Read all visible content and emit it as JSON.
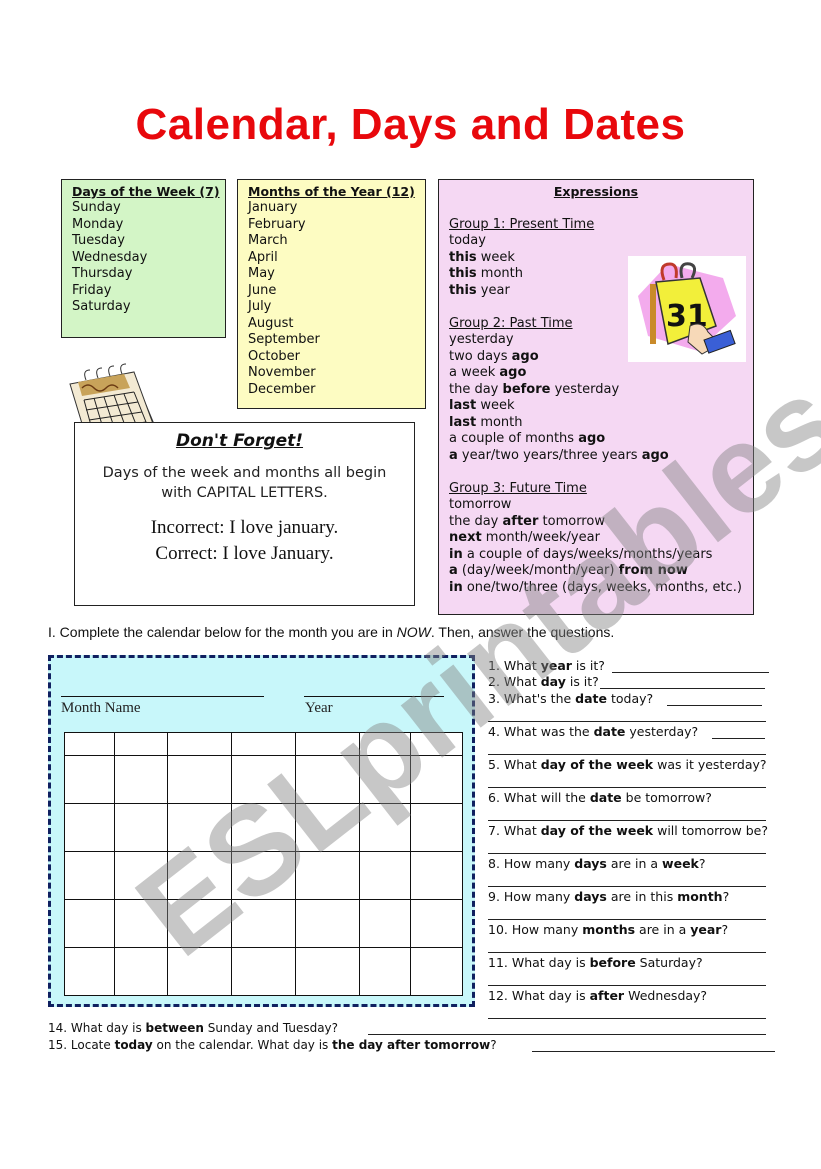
{
  "title": "Calendar, Days and Dates",
  "days_box": {
    "heading": "Days of the Week (7)",
    "items": [
      "Sunday",
      "Monday",
      "Tuesday",
      "Wednesday",
      "Thursday",
      "Friday",
      "Saturday"
    ]
  },
  "months_box": {
    "heading": "Months of the Year (12)",
    "items": [
      "January",
      "February",
      "March",
      "April",
      "May",
      "June",
      "July",
      "August",
      "September",
      "October",
      "November",
      "December"
    ]
  },
  "expressions": {
    "heading": "Expressions",
    "groups": [
      {
        "title": "Group 1:  Present Time",
        "items": [
          {
            "bold": "",
            "rest": "today"
          },
          {
            "bold": "this",
            "rest": " week"
          },
          {
            "bold": "this",
            "rest": " month"
          },
          {
            "bold": "this",
            "rest": " year"
          }
        ]
      },
      {
        "title": "Group 2:  Past Time",
        "items": [
          {
            "pre": "yesterday"
          },
          {
            "pre": "two days ",
            "bold": "ago"
          },
          {
            "pre": "a week ",
            "bold": "ago"
          },
          {
            "pre": "the day ",
            "bold": "before",
            "post": " yesterday"
          },
          {
            "bold": "last",
            "post": " week"
          },
          {
            "bold": "last",
            "post": " month"
          },
          {
            "pre": "a couple of months ",
            "bold": "ago"
          },
          {
            "bold": "a",
            "post": " year/two years/three years ",
            "bold2": "ago"
          }
        ]
      },
      {
        "title": "Group 3:  Future Time",
        "items": [
          {
            "pre": "tomorrow"
          },
          {
            "pre": "the day ",
            "bold": "after",
            "post": " tomorrow"
          },
          {
            "bold": "next",
            "post": " month/week/year"
          },
          {
            "bold": "in",
            "post": " a couple of days/weeks/months/years"
          },
          {
            "bold": "a",
            "post": " (day/week/month/year)  ",
            "bold2": "from now"
          },
          {
            "bold": "in",
            "post": " one/two/three (days, weeks, months, etc.)"
          }
        ]
      }
    ]
  },
  "images": {
    "calendar_clipart": "calendar-clipart",
    "day31_clipart": "31"
  },
  "note": {
    "title": "Don't Forget!",
    "body_line1": "Days of the week and months all begin",
    "body_line2": "with CAPITAL LETTERS.",
    "incorrect": "Incorrect: I love january.",
    "correct": "Correct:  I love January."
  },
  "instruction": {
    "prefix": "I.  Complete the calendar below for the month you are in ",
    "emph": "NOW",
    "suffix": ".  Then, answer the questions."
  },
  "calendar": {
    "month_label": "Month Name",
    "year_label": "Year",
    "rows": 6,
    "cols": 7
  },
  "questions": [
    {
      "n": "1.",
      "pre": " What ",
      "bold": "year",
      "post": " is it?"
    },
    {
      "n": "2.",
      "pre": " What ",
      "bold": "day",
      "post": " is it?"
    },
    {
      "n": "3.",
      "pre": " What's the ",
      "bold": "date",
      "post": " today?"
    },
    {
      "n": "4.",
      "pre": " What was the ",
      "bold": "date",
      "post": " yesterday?"
    },
    {
      "n": "5.",
      "pre": " What ",
      "bold": "day of the week",
      "post": " was it yesterday?"
    },
    {
      "n": "6.",
      "pre": " What will the ",
      "bold": "date",
      "post": " be tomorrow?"
    },
    {
      "n": "7.",
      "pre": " What ",
      "bold": "day of the week",
      "post": " will tomorrow be?"
    },
    {
      "n": "8.",
      "pre": "  How many ",
      "bold": "days",
      "post": " are in a ",
      "bold2": "week",
      "post2": "?"
    },
    {
      "n": "9.",
      "pre": "  How many ",
      "bold": "days",
      "post": " are in this ",
      "bold2": "month",
      "post2": "?"
    },
    {
      "n": "10.",
      "pre": "  How many ",
      "bold": "months",
      "post": " are in a ",
      "bold2": "year",
      "post2": "?"
    },
    {
      "n": "11.",
      "pre": "  What day is ",
      "bold": "before",
      "post": " Saturday?"
    },
    {
      "n": "12.",
      "pre": "  What day is ",
      "bold": "after",
      "post": " Wednesday?"
    },
    {
      "n": "14.",
      "pre": "  What day is ",
      "bold": "between",
      "post": " Sunday and Tuesday?"
    },
    {
      "n": "15.",
      "pre": "  Locate ",
      "bold": "today",
      "post": " on the calendar.   What day is ",
      "bold2": "the day after tomorrow",
      "post2": "?"
    }
  ],
  "watermark": "ESLprintables.com",
  "colors": {
    "title": "#e8080c",
    "days_bg": "#d3f5c6",
    "months_bg": "#fdfcc2",
    "expressions_bg": "#f5d8f3",
    "calendar_bg": "#c8f7fa",
    "calendar_border": "#102060"
  }
}
